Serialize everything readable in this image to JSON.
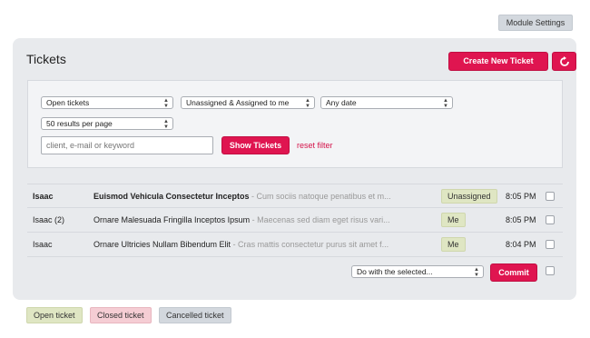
{
  "header": {
    "module_settings_label": "Module Settings"
  },
  "panel": {
    "title": "Tickets",
    "create_label": "Create New Ticket",
    "refresh_icon": "refresh-icon"
  },
  "filters": {
    "status": "Open tickets",
    "assignment": "Unassigned & Assigned to me",
    "date": "Any date",
    "per_page": "50 results per page",
    "search_placeholder": "client, e-mail or keyword",
    "show_label": "Show Tickets",
    "reset_label": "reset filter"
  },
  "tickets": [
    {
      "name": "Isaac",
      "subject": "Euismod Vehicula Consectetur Inceptos",
      "preview": " - Cum sociis natoque penatibus et m...",
      "badge": "Unassigned",
      "time": "8:05 PM",
      "unread": true
    },
    {
      "name": "Isaac (2)",
      "subject": "Ornare Malesuada Fringilla Inceptos Ipsum",
      "preview": " - Maecenas sed diam eget risus vari...",
      "badge": "Me",
      "time": "8:05 PM",
      "unread": false
    },
    {
      "name": "Isaac",
      "subject": "Ornare Ultricies Nullam Bibendum Elit",
      "preview": " - Cras mattis consectetur purus sit amet f...",
      "badge": "Me",
      "time": "8:04 PM",
      "unread": false
    }
  ],
  "bulk": {
    "action": "Do with the selected...",
    "commit_label": "Commit"
  },
  "legend": {
    "open": "Open ticket",
    "closed": "Closed ticket",
    "cancelled": "Cancelled ticket"
  },
  "colors": {
    "accent": "#df1550",
    "open": "#dfe6c3",
    "closed": "#f5cdd4",
    "cancelled": "#d3d8de"
  }
}
